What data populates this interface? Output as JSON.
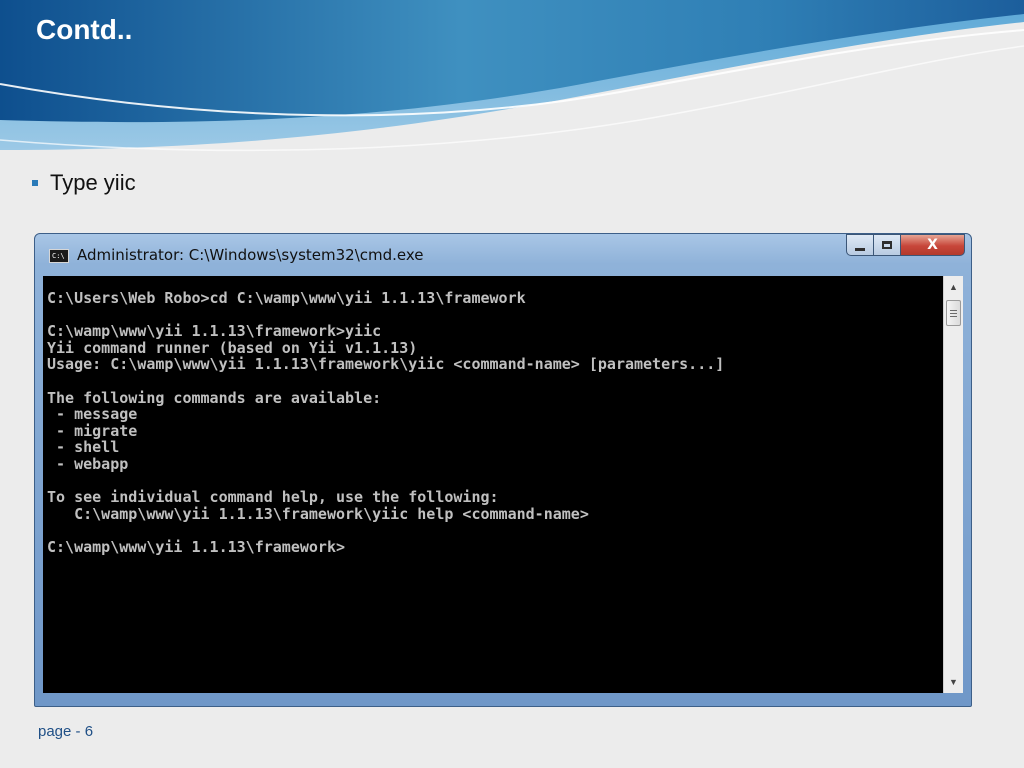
{
  "slide": {
    "title": "Contd..",
    "bullet": "Type yiic",
    "page_number": "page - 6"
  },
  "window": {
    "title": "Administrator: C:\\Windows\\system32\\cmd.exe",
    "icon_label": "C:\\",
    "close_glyph": "X",
    "scroll_up_glyph": "▲",
    "scroll_down_glyph": "▼"
  },
  "console": {
    "text": "C:\\Users\\Web Robo>cd C:\\wamp\\www\\yii 1.1.13\\framework\n\nC:\\wamp\\www\\yii 1.1.13\\framework>yiic\nYii command runner (based on Yii v1.1.13)\nUsage: C:\\wamp\\www\\yii 1.1.13\\framework\\yiic <command-name> [parameters...]\n\nThe following commands are available:\n - message\n - migrate\n - shell\n - webapp\n\nTo see individual command help, use the following:\n   C:\\wamp\\www\\yii 1.1.13\\framework\\yiic help <command-name>\n\nC:\\wamp\\www\\yii 1.1.13\\framework>"
  },
  "colors": {
    "header_blue": "#1d5f9e",
    "console_bg": "#000000",
    "console_fg": "#c0c0c0",
    "page_number": "#1f4f86"
  }
}
